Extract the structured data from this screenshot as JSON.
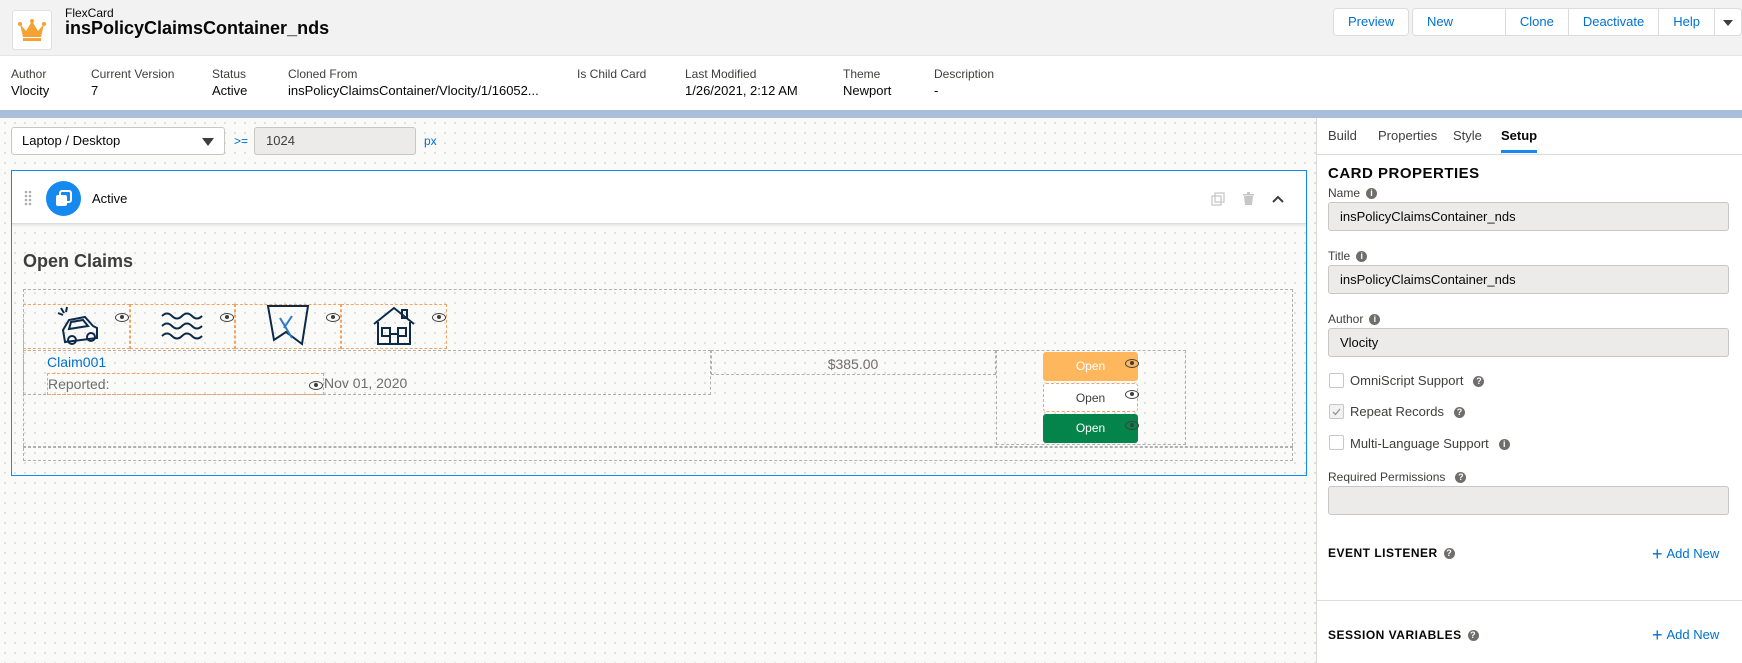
{
  "header": {
    "crumb": "FlexCard",
    "title": "insPolicyClaimsContainer_nds",
    "buttons": {
      "preview": "Preview",
      "new_version": "New Version",
      "clone": "Clone",
      "deactivate": "Deactivate",
      "help": "Help"
    }
  },
  "meta": {
    "author_label": "Author",
    "author": "Vlocity",
    "version_label": "Current Version",
    "version": "7",
    "status_label": "Status",
    "status": "Active",
    "cloned_label": "Cloned From",
    "cloned": "insPolicyClaimsContainer/Vlocity/1/16052...",
    "child_label": "Is Child Card",
    "modified_label": "Last Modified",
    "modified": "1/26/2021, 2:12 AM",
    "theme_label": "Theme",
    "theme": "Newport",
    "desc_label": "Description",
    "desc": "-"
  },
  "canvas": {
    "device": "Laptop / Desktop",
    "gte": ">=",
    "width": "1024",
    "unit": "px",
    "state_label": "Active",
    "card_title": "Open Claims",
    "claim_name": "Claim001",
    "reported_label": "Reported:",
    "reported_date": "Nov 01, 2020",
    "amount": "$385.00",
    "open1": "Open",
    "open2": "Open",
    "open3": "Open"
  },
  "panel": {
    "tabs": {
      "build": "Build",
      "properties": "Properties",
      "style": "Style",
      "setup": "Setup"
    },
    "card_properties": "CARD PROPERTIES",
    "name_label": "Name",
    "name_value": "insPolicyClaimsContainer_nds",
    "title_label": "Title",
    "title_value": "insPolicyClaimsContainer_nds",
    "author_label": "Author",
    "author_value": "Vlocity",
    "omni_label": "OmniScript Support",
    "repeat_label": "Repeat Records",
    "multilang_label": "Multi-Language Support",
    "perm_label": "Required Permissions",
    "event_listener": "EVENT LISTENER",
    "session_vars": "SESSION VARIABLES",
    "add_new_1": "Add New",
    "add_new_2": "Add New"
  },
  "colors": {
    "accent": "#1589ee",
    "link": "#0070d2",
    "open_warning": "#ffb75d",
    "open_success": "#04844b"
  }
}
